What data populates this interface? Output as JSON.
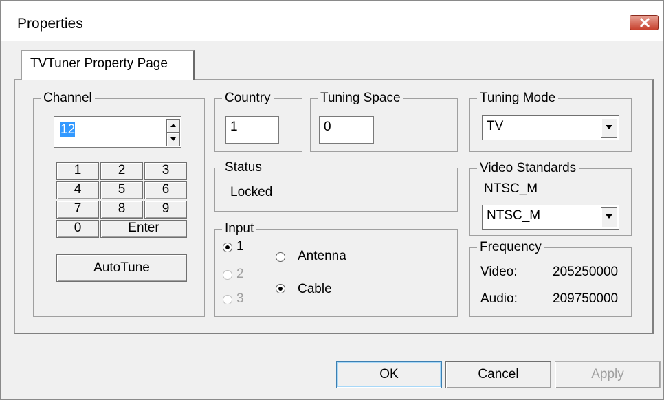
{
  "window": {
    "title": "Properties"
  },
  "tabs": [
    {
      "label": "TVTuner Property Page"
    }
  ],
  "channel": {
    "legend": "Channel",
    "value": "12",
    "keypad": [
      "1",
      "2",
      "3",
      "4",
      "5",
      "6",
      "7",
      "8",
      "9",
      "0"
    ],
    "enter_label": "Enter",
    "autotune_label": "AutoTune"
  },
  "country": {
    "legend": "Country",
    "value": "1"
  },
  "tuning_space": {
    "legend": "Tuning Space",
    "value": "0"
  },
  "tuning_mode": {
    "legend": "Tuning Mode",
    "value": "TV"
  },
  "status": {
    "legend": "Status",
    "value": "Locked"
  },
  "input": {
    "legend": "Input",
    "ports": [
      "1",
      "2",
      "3"
    ],
    "selected_port": "1",
    "types": [
      "Antenna",
      "Cable"
    ],
    "selected_type": "Cable"
  },
  "video_standards": {
    "legend": "Video Standards",
    "current": "NTSC_M",
    "selected": "NTSC_M"
  },
  "frequency": {
    "legend": "Frequency",
    "video_label": "Video:",
    "video_value": "205250000",
    "audio_label": "Audio:",
    "audio_value": "209750000"
  },
  "buttons": {
    "ok": "OK",
    "cancel": "Cancel",
    "apply": "Apply"
  },
  "colors": {
    "selection": "#3399ff",
    "close_button": "#c7422f"
  }
}
